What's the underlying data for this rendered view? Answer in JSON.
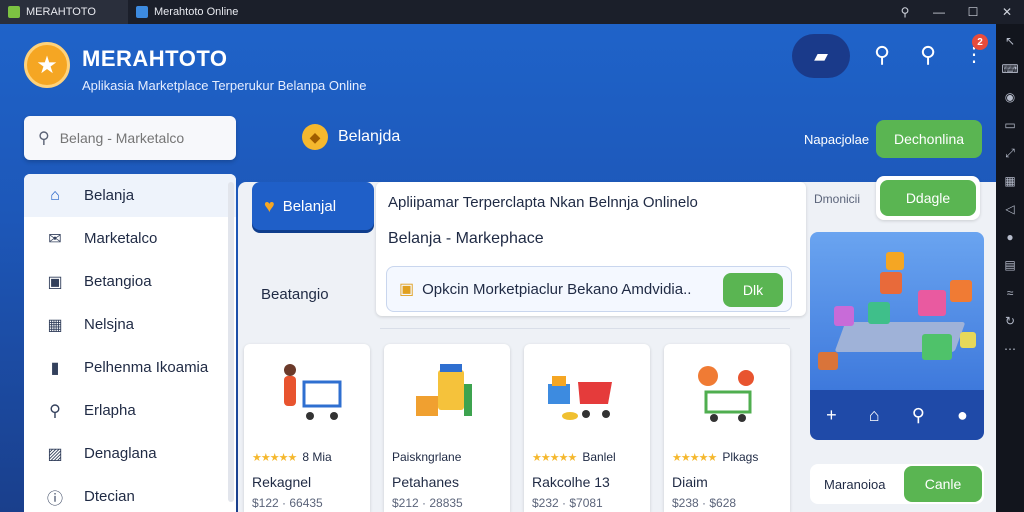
{
  "os": {
    "tabs": [
      {
        "label": "MERAHTOTO",
        "color": "#7cc242"
      },
      {
        "label": "Merahtoto Online",
        "color": "#3d8be0"
      }
    ],
    "controls": [
      "⚲",
      "—",
      "☐",
      "✕"
    ]
  },
  "header": {
    "brand": "MERAHTOTO",
    "tagline": "Aplikasia Marketplace Terperukur Belanpa Online",
    "notif_count": "2"
  },
  "search": {
    "placeholder": "Belang - Marketalco"
  },
  "main_tab": {
    "label": "Belanjda"
  },
  "header_right": {
    "label": "Napacjolae",
    "button": "Dechonlina"
  },
  "sidebar": {
    "items": [
      {
        "label": "Belanja",
        "icon": "home-icon",
        "active": true
      },
      {
        "label": "Marketalco",
        "icon": "mail-icon"
      },
      {
        "label": "Betangioa",
        "icon": "bag-icon"
      },
      {
        "label": "Nelsjna",
        "icon": "calendar-icon"
      },
      {
        "label": "Pelhenma Ikoamia",
        "icon": "bookmark-icon"
      },
      {
        "label": "Erlapha",
        "icon": "search-icon"
      },
      {
        "label": "Denaglana",
        "icon": "image-icon"
      },
      {
        "label": "Dtecian",
        "icon": "info-icon"
      }
    ]
  },
  "panel": {
    "tab": "Belanjal",
    "info_title": "Apliipamar Terperclapta Nkan Belnnja Onlinelo",
    "info_sub": "Belanja - Markephace",
    "promo": "Opkcin Morketpiaclur Bekano Amdvidia..",
    "promo_button": "Dlk",
    "side_label": "Beatangio",
    "right_label": "Dmonicii",
    "right_button": "Ddagle"
  },
  "illus_bar": [
    "+",
    "⌂",
    "⚲",
    "●"
  ],
  "bottom_card": {
    "label": "Maranoioa",
    "button": "Canle"
  },
  "products": [
    {
      "rating": "8 Mia",
      "name": "Rekagnel",
      "price": "$122 · 66435"
    },
    {
      "rating": "Paiskngrlane",
      "name": "Petahanes",
      "price": "$212 · 28835"
    },
    {
      "rating": "Banlel",
      "name": "Rakcolhe 13",
      "price": "$232 · $7081"
    },
    {
      "rating": "Plkags",
      "name": "Diaim",
      "price": "$238 · $628"
    }
  ],
  "stars": "★★★★★",
  "colors": {
    "accent": "#1f5fc8",
    "green": "#5ab552",
    "orange": "#f5a623"
  }
}
